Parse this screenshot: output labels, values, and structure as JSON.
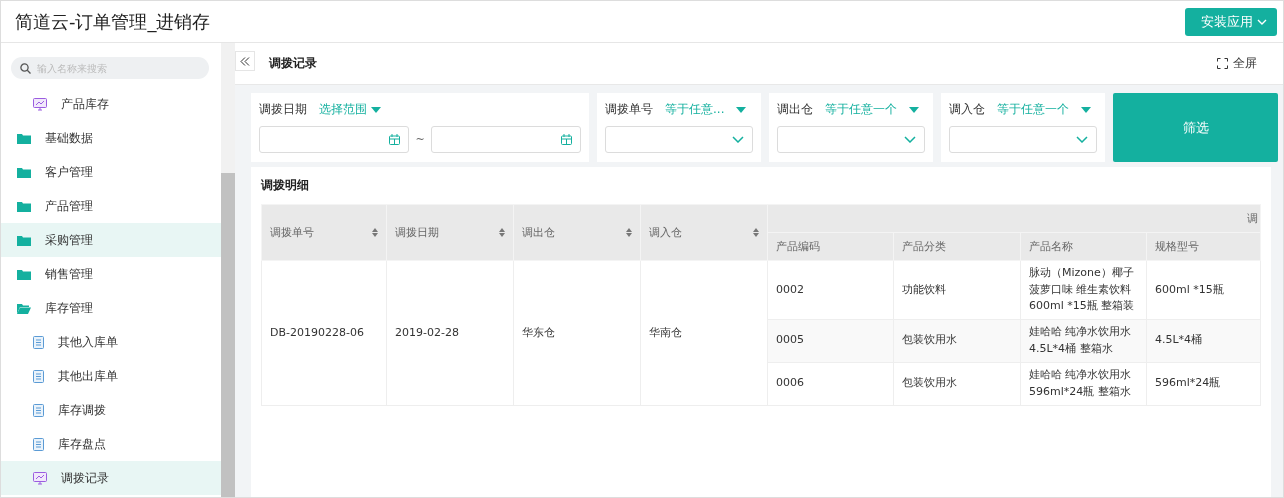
{
  "window": {
    "title": "简道云-订单管理_进销存",
    "install_button": "安装应用"
  },
  "sidebar": {
    "search": {
      "placeholder": "输入名称来搜索"
    },
    "items": [
      {
        "label": "产品库存",
        "kind": "dashboard",
        "selected": false
      },
      {
        "label": "基础数据",
        "kind": "folder",
        "selected": false,
        "expanded": false
      },
      {
        "label": "客户管理",
        "kind": "folder",
        "selected": false,
        "expanded": false
      },
      {
        "label": "产品管理",
        "kind": "folder",
        "selected": false,
        "expanded": false
      },
      {
        "label": "采购管理",
        "kind": "folder",
        "selected": true,
        "expanded": false
      },
      {
        "label": "销售管理",
        "kind": "folder",
        "selected": false,
        "expanded": false
      },
      {
        "label": "库存管理",
        "kind": "folder",
        "selected": false,
        "expanded": true,
        "children": [
          {
            "label": "其他入库单",
            "kind": "form",
            "selected": false
          },
          {
            "label": "其他出库单",
            "kind": "form",
            "selected": false
          },
          {
            "label": "库存调拨",
            "kind": "form",
            "selected": false
          },
          {
            "label": "库存盘点",
            "kind": "form",
            "selected": false
          },
          {
            "label": "调拨记录",
            "kind": "dashboard",
            "selected": true
          }
        ]
      }
    ]
  },
  "page": {
    "title": "调拨记录",
    "fullscreen": "全屏"
  },
  "filters": [
    {
      "kind": "date_range",
      "label": "调拨日期",
      "mode": "选择范围",
      "separator": "~"
    },
    {
      "kind": "select",
      "label": "调拨单号",
      "mode": "等于任意..."
    },
    {
      "kind": "select",
      "label": "调出仓",
      "mode": "等于任意一个"
    },
    {
      "kind": "select",
      "label": "调入仓",
      "mode": "等于任意一个"
    }
  ],
  "filter_button": "筛选",
  "table": {
    "title": "调拨明细",
    "columns": [
      "调拨单号",
      "调拨日期",
      "调出仓",
      "调入仓"
    ],
    "group": "调",
    "sub_columns": [
      "产品编码",
      "产品分类",
      "产品名称",
      "规格型号"
    ],
    "rows": [
      {
        "cells": [
          "DB-20190228-06",
          "2019-02-28",
          "华东仓",
          "华南仓"
        ],
        "items": [
          [
            "0002",
            "功能饮料",
            "脉动（Mizone）椰子菠萝口味 维生素饮料600ml *15瓶 整箱装",
            "600ml *15瓶"
          ],
          [
            "0005",
            "包装饮用水",
            "娃哈哈 纯净水饮用水4.5L*4桶 整箱水",
            "4.5L*4桶"
          ],
          [
            "0006",
            "包装饮用水",
            "娃哈哈 纯净水饮用水596ml*24瓶 整箱水",
            "596ml*24瓶"
          ]
        ]
      }
    ]
  }
}
